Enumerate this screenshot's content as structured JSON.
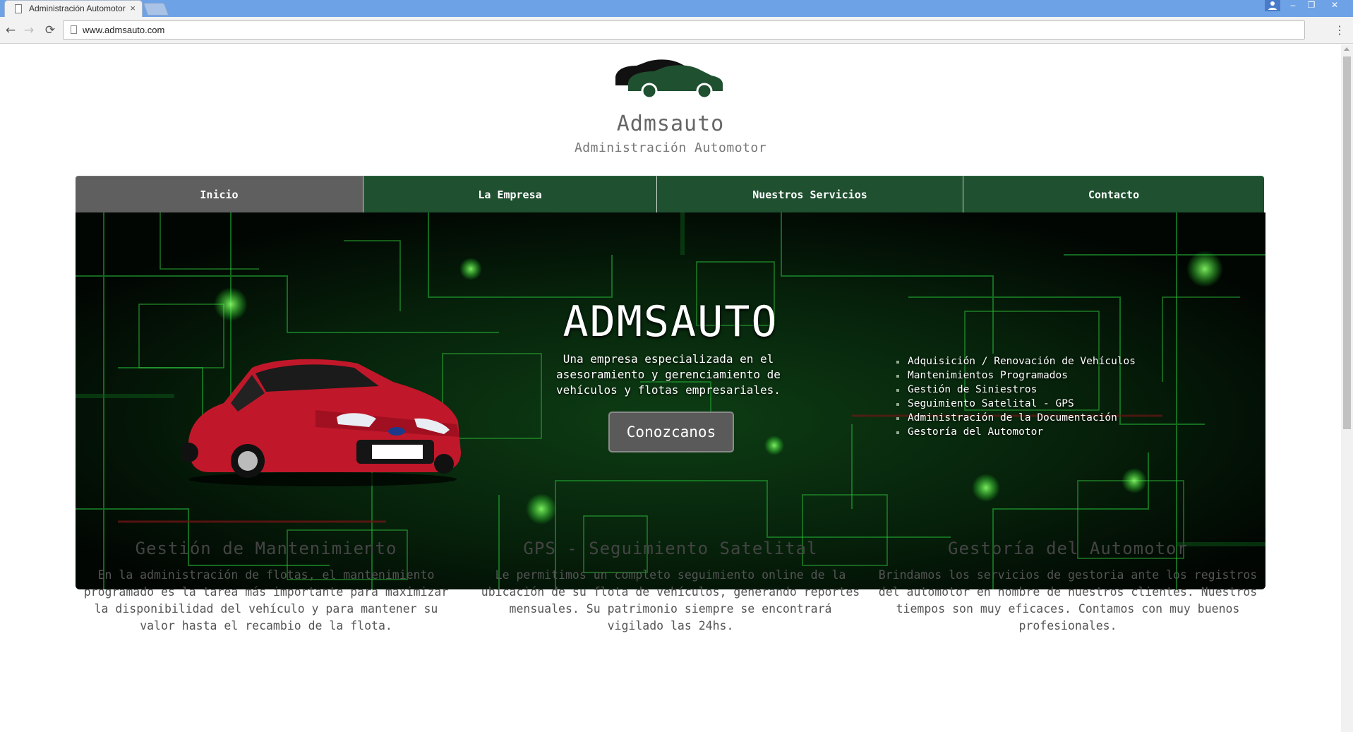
{
  "browser": {
    "tab_title": "Administración Automotor",
    "tab_close": "×",
    "url": "www.admsauto.com",
    "icons": {
      "back": "back-arrow-icon",
      "forward": "forward-arrow-icon",
      "reload": "reload-icon",
      "menu": "kebab-menu-icon",
      "profile": "profile-icon"
    },
    "window_controls": {
      "minimize": "–",
      "restore": "❐",
      "close": "✕"
    },
    "nav_glyphs": {
      "back": "←",
      "forward": "→",
      "reload": "⟳",
      "menu": "⋮"
    }
  },
  "site": {
    "name": "Admsauto",
    "tagline": "Administración Automotor",
    "colors": {
      "nav_green": "#1f5030",
      "nav_active": "#5f5f5f",
      "hero_bg": "#020803",
      "logo_green": "#1f5030"
    }
  },
  "nav": {
    "items": [
      {
        "label": "Inicio",
        "active": true
      },
      {
        "label": "La Empresa",
        "active": false
      },
      {
        "label": "Nuestros Servicios",
        "active": false
      },
      {
        "label": "Contacto",
        "active": false
      }
    ]
  },
  "hero": {
    "title": "ADMSAUTO",
    "description": "Una empresa especializada en el asesoramiento y gerenciamiento de vehículos y flotas empresariales.",
    "button_label": "Conozcanos",
    "services": [
      "Adquisición / Renovación de Vehículos",
      "Mantenimientos Programados",
      "Gestión de Siniestros",
      "Seguimiento Satelital - GPS",
      "Administración de la Documentación",
      "Gestoría del Automotor"
    ]
  },
  "features": [
    {
      "title": "Gestión de Mantenimiento",
      "text": "En la administración de flotas, el mantenimiento programado es la tarea más importante para maximizar la disponibilidad del vehículo y para mantener su valor hasta el recambio de la flota."
    },
    {
      "title": "GPS - Seguimiento Satelital",
      "text": "Le permitimos un completo seguimiento online de la ubicación de su flota de vehículos, generando reportes mensuales. Su patrimonio siempre se encontrará vigilado las 24hs."
    },
    {
      "title": "Gestoría del Automotor",
      "text": "Brindamos los servicios de gestoria ante los registros del automotor en nombre de nuestros clientes. Nuestros tiempos son muy eficaces. Contamos con muy buenos profesionales."
    }
  ]
}
